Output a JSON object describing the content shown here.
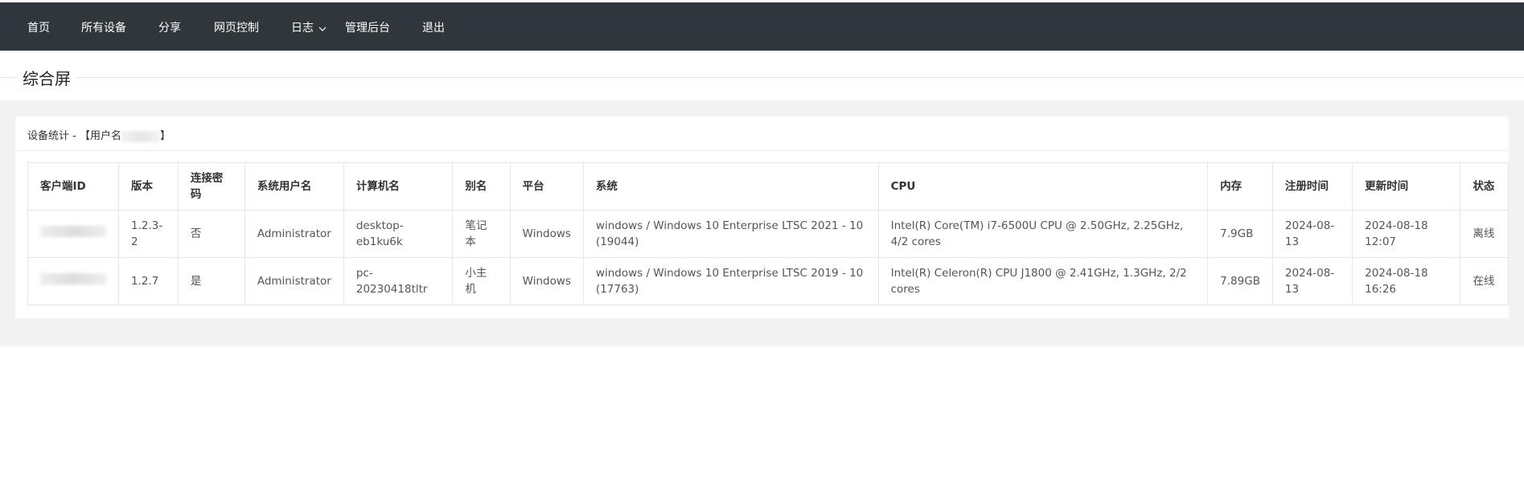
{
  "nav": {
    "items": [
      "首页",
      "所有设备",
      "分享",
      "网页控制",
      "日志",
      "管理后台",
      "退出"
    ]
  },
  "page": {
    "title": "综合屏"
  },
  "card": {
    "title_prefix": "设备统计 - 【用户名",
    "title_suffix": "】"
  },
  "table": {
    "headers": [
      "客户端ID",
      "版本",
      "连接密码",
      "系统用户名",
      "计算机名",
      "别名",
      "平台",
      "系统",
      "CPU",
      "内存",
      "注册时间",
      "更新时间",
      "状态"
    ],
    "rows": [
      {
        "version": "1.2.3-2",
        "password": "否",
        "sys_user": "Administrator",
        "computer": "desktop-eb1ku6k",
        "alias": "笔记本",
        "platform": "Windows",
        "system": "windows / Windows 10 Enterprise LTSC 2021 - 10 (19044)",
        "cpu": "Intel(R) Core(TM) i7-6500U CPU @ 2.50GHz, 2.25GHz, 4/2 cores",
        "memory": "7.9GB",
        "registered": "2024-08-13",
        "updated": "2024-08-18 12:07",
        "status": "离线"
      },
      {
        "version": "1.2.7",
        "password": "是",
        "sys_user": "Administrator",
        "computer": "pc-20230418tltr",
        "alias": "小主机",
        "platform": "Windows",
        "system": "windows / Windows 10 Enterprise LTSC 2019 - 10 (17763)",
        "cpu": "Intel(R) Celeron(R) CPU J1800 @ 2.41GHz, 1.3GHz, 2/2 cores",
        "memory": "7.89GB",
        "registered": "2024-08-13",
        "updated": "2024-08-18 16:26",
        "status": "在线"
      }
    ]
  }
}
